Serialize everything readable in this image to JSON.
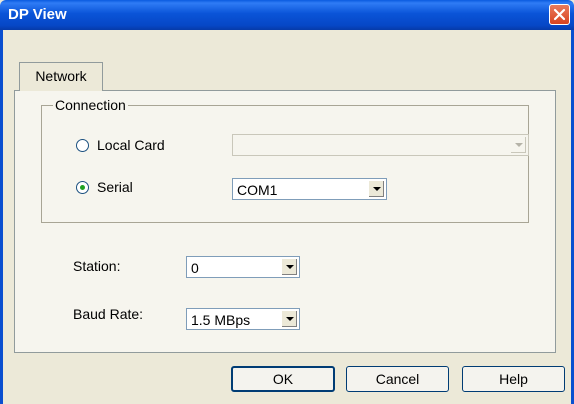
{
  "window": {
    "title": "DP View"
  },
  "tabs": [
    {
      "label": "Network"
    }
  ],
  "connection": {
    "group_label": "Connection",
    "local_card": {
      "label": "Local Card",
      "selected": false,
      "value": ""
    },
    "serial": {
      "label": "Serial",
      "selected": true,
      "value": "COM1"
    }
  },
  "station": {
    "label": "Station:",
    "value": "0"
  },
  "baud_rate": {
    "label": "Baud Rate:",
    "value": "1.5 MBps"
  },
  "buttons": {
    "ok": "OK",
    "cancel": "Cancel",
    "help": "Help"
  },
  "icons": {
    "close": "close-icon",
    "dropdown": "chevron-down-icon"
  },
  "colors": {
    "titlebar": "#0a54d8",
    "close": "#d9431f",
    "radio_dot": "#21a121",
    "dialog_bg": "#ece9d8"
  }
}
